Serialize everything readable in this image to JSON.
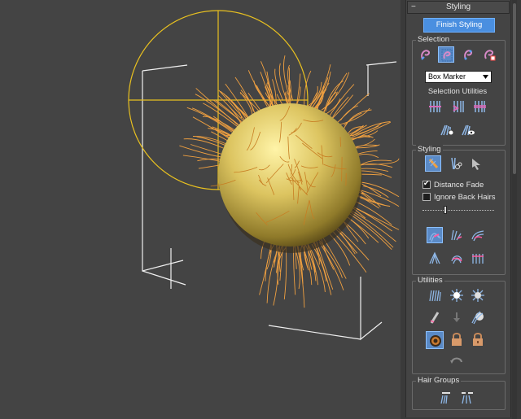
{
  "panel": {
    "rollout_title": "Styling",
    "collapse_symbol": "−",
    "finish_button": "Finish Styling",
    "selection": {
      "label": "Selection",
      "tools": [
        "select-hair-by-ends-icon",
        "select-whole-guide-icon",
        "select-guide-vertices-icon",
        "select-by-root-icon"
      ],
      "active_tool": 1,
      "marker_dropdown": "Box Marker",
      "utilities_label": "Selection Utilities",
      "utility_tools": [
        "invert-selection-icon",
        "rotate-selection-icon",
        "grow-selection-icon",
        "select-hidden-icon",
        "hide-selected-icon"
      ]
    },
    "styling": {
      "label": "Styling",
      "tools": [
        "hair-brush-icon",
        "hair-cut-icon",
        "select-arrow-icon"
      ],
      "active_tool": 0,
      "distance_fade_label": "Distance Fade",
      "distance_fade_checked": true,
      "ignore_back_label": "Ignore Back Hairs",
      "ignore_back_checked": false,
      "brush_size_fraction": 0.3,
      "brush_modes": [
        "translate-icon",
        "stand-icon",
        "puff-roots-icon",
        "clump-icon",
        "rotate-icon",
        "scale-icon"
      ],
      "active_brush_mode": 0
    },
    "utilities": {
      "label": "Utilities",
      "tools": [
        "attenuate-icon",
        "pop-selected-icon",
        "pop-zero-icon",
        "recomb-icon",
        "reset-rest-icon",
        "toggle-collisions-icon",
        "toggle-hair-icon",
        "lock-icon",
        "unlock-icon",
        "undo-icon"
      ]
    },
    "hair_groups": {
      "label": "Hair Groups",
      "tools": [
        "split-groups-icon",
        "merge-groups-icon"
      ]
    }
  },
  "colors": {
    "accent": "#4a8fe0",
    "viewport_bg": "#444444",
    "hair": "#f0a040",
    "gizmo": "#e8c020",
    "sphere": "#d8bf58"
  }
}
